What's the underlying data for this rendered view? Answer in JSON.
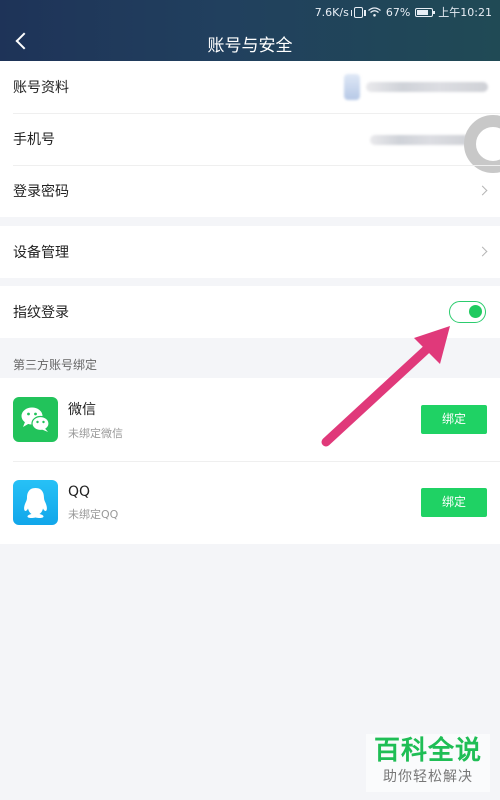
{
  "status_bar": {
    "speed": "7.6K/s",
    "battery": "67%",
    "time": "上午10:21"
  },
  "header": {
    "title": "账号与安全"
  },
  "account_group": {
    "items": [
      {
        "label": "账号资料"
      },
      {
        "label": "手机号"
      },
      {
        "label": "登录密码"
      }
    ]
  },
  "device_group": {
    "label": "设备管理"
  },
  "fingerprint": {
    "label": "指纹登录",
    "enabled": true
  },
  "third_party": {
    "section_label": "第三方账号绑定",
    "items": [
      {
        "name": "微信",
        "status": "未绑定微信",
        "button": "绑定",
        "icon": "wechat-icon"
      },
      {
        "name": "QQ",
        "status": "未绑定QQ",
        "button": "绑定",
        "icon": "qq-icon"
      }
    ]
  },
  "watermark": {
    "main": "百科全说",
    "sub": "助你轻松解决"
  },
  "colors": {
    "accent": "#1fd264",
    "header": "#21405e",
    "arrow": "#e0397a"
  }
}
